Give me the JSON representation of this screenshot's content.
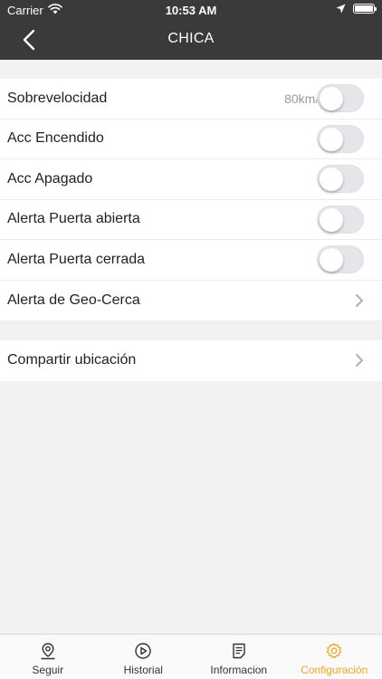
{
  "status_bar": {
    "carrier": "Carrier",
    "time": "10:53 AM"
  },
  "nav": {
    "title": "CHICA"
  },
  "settings": {
    "group1": [
      {
        "label": "Sobrevelocidad",
        "value": "80km/h",
        "control": "toggle",
        "on": false
      },
      {
        "label": "Acc Encendido",
        "control": "toggle",
        "on": false
      },
      {
        "label": "Acc Apagado",
        "control": "toggle",
        "on": false
      },
      {
        "label": "Alerta Puerta abierta",
        "control": "toggle",
        "on": false
      },
      {
        "label": "Alerta Puerta cerrada",
        "control": "toggle",
        "on": false
      },
      {
        "label": "Alerta de Geo-Cerca",
        "control": "chevron"
      }
    ],
    "group2": [
      {
        "label": "Compartir ubicación",
        "control": "chevron"
      }
    ]
  },
  "tabs": [
    {
      "label": "Seguir",
      "icon": "location-pin-icon",
      "active": false
    },
    {
      "label": "Historial",
      "icon": "play-circle-icon",
      "active": false
    },
    {
      "label": "Informacion",
      "icon": "document-icon",
      "active": false
    },
    {
      "label": "Configuración",
      "icon": "gear-icon",
      "active": true
    }
  ],
  "colors": {
    "header_bg": "#3a3a3a",
    "accent": "#f5a623",
    "background": "#f2f2f2",
    "toggle_off": "#e5e5ea"
  }
}
